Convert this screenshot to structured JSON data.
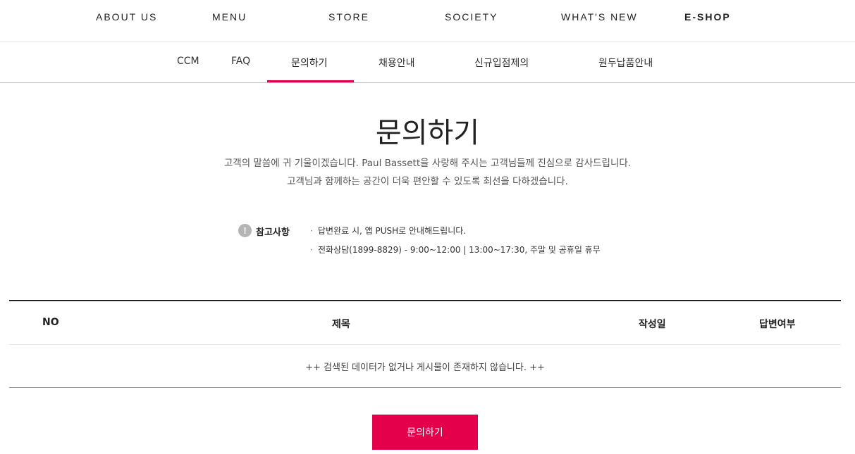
{
  "gnb": {
    "items": [
      {
        "label": "ABOUT US"
      },
      {
        "label": "MENU"
      },
      {
        "label": "STORE"
      },
      {
        "label": "SOCIETY"
      },
      {
        "label": "WHAT'S NEW"
      },
      {
        "label": "E-SHOP"
      }
    ]
  },
  "subnav": {
    "items": [
      {
        "label": "CCM"
      },
      {
        "label": "FAQ"
      },
      {
        "label": "문의하기"
      },
      {
        "label": "채용안내"
      },
      {
        "label": "신규입점제의"
      },
      {
        "label": "원두납품안내"
      }
    ],
    "active": "문의하기"
  },
  "page": {
    "title": "문의하기",
    "desc_line1": "고객의 말씀에 귀 기울이겠습니다. Paul Bassett을 사랑해 주시는 고객님들께 진심으로 감사드립니다.",
    "desc_line2": "고객님과 함께하는 공간이 더욱 편안할 수 있도록 최선을 다하겠습니다."
  },
  "notice": {
    "icon": "!",
    "label": "참고사항",
    "lines": [
      "답변완료 시, 앱 PUSH로 안내해드립니다.",
      "전화상담(1899-8829) - 9:00~12:00 | 13:00~17:30, 주말 및 공휴일 휴무"
    ]
  },
  "table": {
    "headers": [
      "NO",
      "제목",
      "작성일",
      "답변여부"
    ],
    "empty_message": "++ 검색된 데이터가 없거나 게시물이 존재하지 않습니다. ++"
  },
  "actions": {
    "inquiry_button": "문의하기"
  },
  "colors": {
    "accent": "#e4004b"
  }
}
